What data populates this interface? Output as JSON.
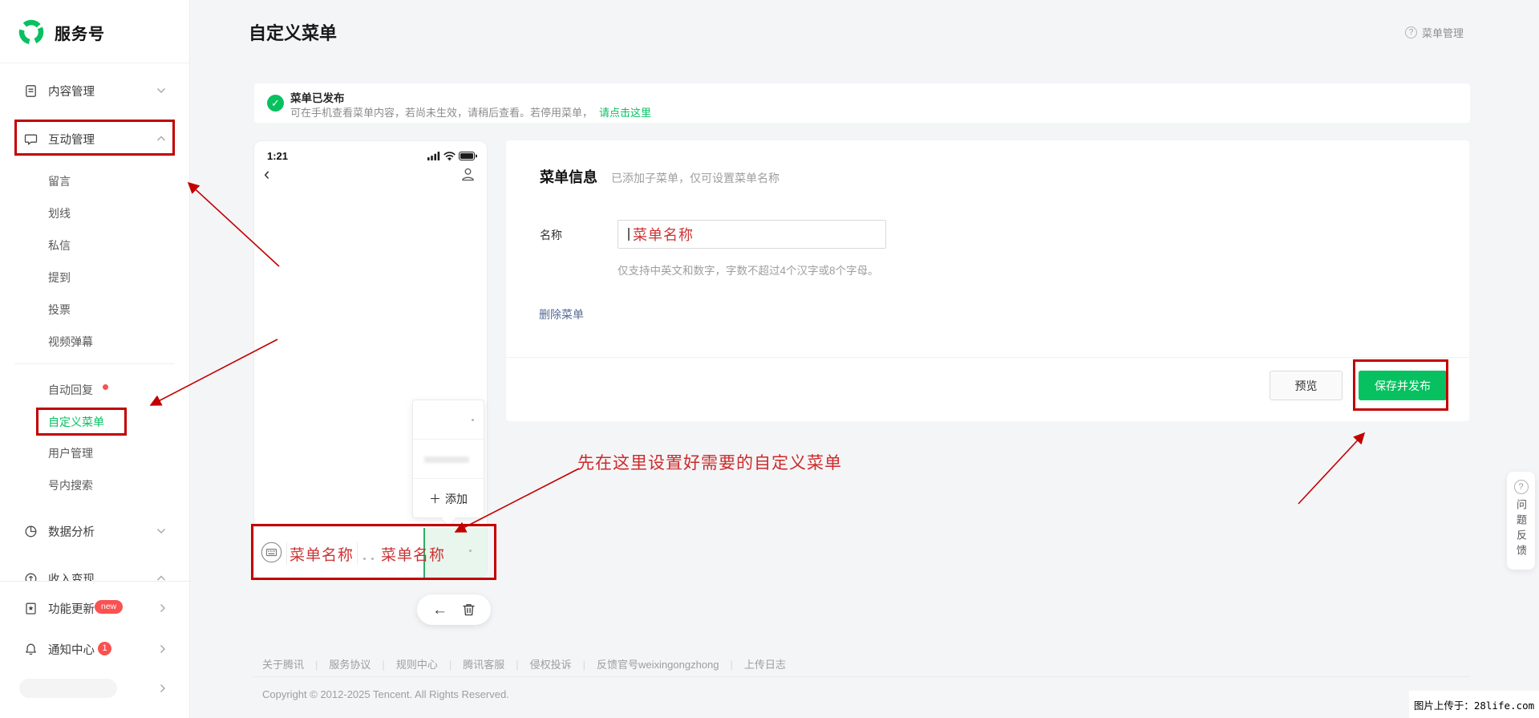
{
  "brand": {
    "name": "服务号"
  },
  "header": {
    "title": "自定义菜单",
    "help_label": "菜单管理"
  },
  "sidebar": {
    "content": {
      "label": "内容管理"
    },
    "interact": {
      "label": "互动管理"
    },
    "interact_children": [
      "留言",
      "划线",
      "私信",
      "提到",
      "投票",
      "视频弹幕"
    ],
    "interact_tools": [
      "自动回复",
      "自定义菜单",
      "用户管理",
      "号内搜索"
    ],
    "analytics": {
      "label": "数据分析"
    },
    "monetize": {
      "label": "收入变现"
    },
    "feature_update": {
      "label": "功能更新",
      "badge": "new"
    },
    "notify_center": {
      "label": "通知中心",
      "badge": "1"
    }
  },
  "notice": {
    "title": "菜单已发布",
    "body": "可在手机查看菜单内容，若尚未生效，请稍后查看。若停用菜单，",
    "link_label": "请点击这里"
  },
  "phone": {
    "status_time": "1:21",
    "popup": {
      "add_label": "添加"
    },
    "menu_item_1": "菜单名称",
    "menu_item_2": "菜单名称"
  },
  "form": {
    "section_title": "菜单信息",
    "section_hint": "已添加子菜单，仅可设置菜单名称",
    "name_label": "名称",
    "name_value": "菜单名称",
    "name_help": "仅支持中英文和数字，字数不超过4个汉字或8个字母。",
    "delete_label": "删除菜单",
    "preview_label": "预览",
    "save_label": "保存并发布"
  },
  "annotation": {
    "tip": "先在这里设置好需要的自定义菜单"
  },
  "feedback": {
    "label": "问题反馈"
  },
  "footer": {
    "links": [
      "关于腾讯",
      "服务协议",
      "规则中心",
      "腾讯客服",
      "侵权投诉",
      "反馈官号weixingongzhong",
      "上传日志"
    ],
    "copyright": "Copyright © 2012-2025 Tencent. All Rights Reserved."
  },
  "watermark": {
    "text": "图片上传于：28life.com"
  },
  "icons": {
    "question": "?",
    "check": "✓",
    "plus": "＋",
    "back_arrow": "←",
    "chevron_left": "‹"
  },
  "colors": {
    "accent": "#07c160",
    "annotation_red": "#c30000",
    "badge_red": "#fa5151",
    "link_blue": "#576b95"
  }
}
